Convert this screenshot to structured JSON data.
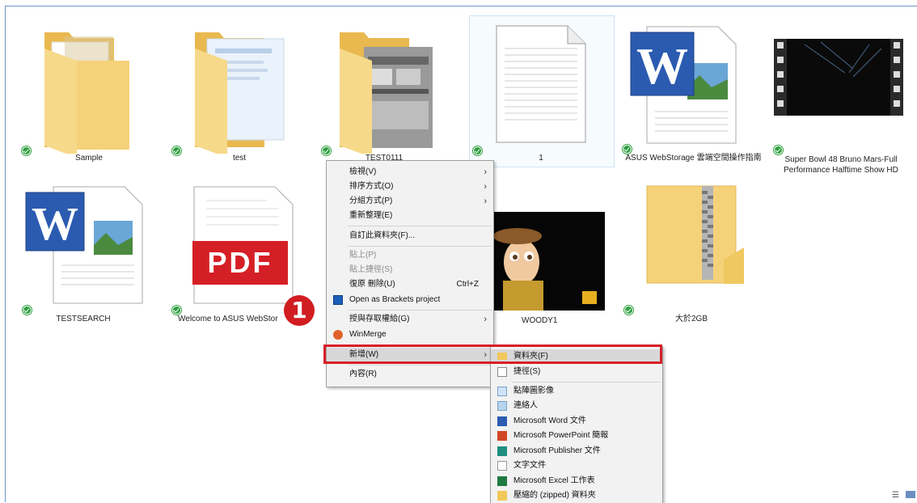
{
  "files": {
    "sample": "Sample",
    "test": "test",
    "test0111": "TEST0111",
    "one": "1",
    "asus_guide": "ASUS WebStorage 雲端空間操作指南",
    "superbowl_1": "Super Bowl 48 Bruno Mars-Full",
    "superbowl_2": "Performance Halftime Show HD",
    "testsearch": "TESTSEARCH",
    "welcome": "Welcome to ASUS WebStor",
    "woody": "WOODY1",
    "big2gb": "大於2GB"
  },
  "context_menu": {
    "view": "檢視(V)",
    "sort": "排序方式(O)",
    "group": "分組方式(P)",
    "refresh": "重新整理(E)",
    "customize": "自訂此資料夾(F)...",
    "paste": "貼上(P)",
    "paste_shortcut": "貼上捷徑(S)",
    "undo": "復原 刪除(U)",
    "undo_key": "Ctrl+Z",
    "brackets": "Open as Brackets project",
    "access": "授與存取權給(G)",
    "winmerge": "WinMerge",
    "new": "新增(W)",
    "properties": "內容(R)"
  },
  "submenu": {
    "folder": "資料夾(F)",
    "shortcut": "捷徑(S)",
    "bitmap": "點陣圖影像",
    "contact": "連絡人",
    "word": "Microsoft Word 文件",
    "ppt": "Microsoft PowerPoint 簡報",
    "publisher": "Microsoft Publisher 文件",
    "text": "文字文件",
    "excel": "Microsoft Excel 工作表",
    "zip": "壓縮的 (zipped) 資料夾"
  },
  "badge": "1",
  "pdf_label": "PDF",
  "colors": {
    "highlight": "#d81f26",
    "folder": "#f5d27a",
    "check": "#2e9e3e"
  }
}
